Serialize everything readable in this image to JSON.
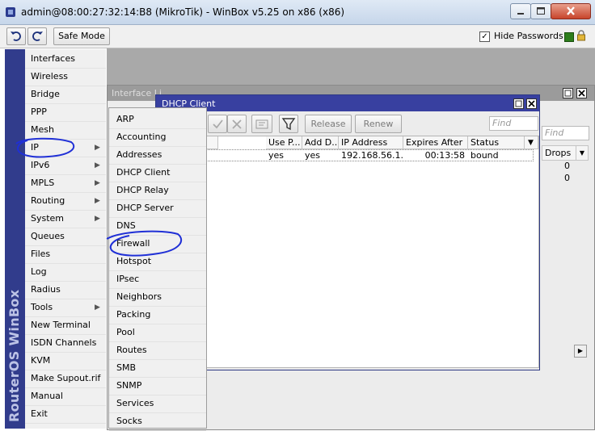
{
  "window": {
    "title": "admin@08:00:27:32:14:B8 (MikroTik) - WinBox v5.25 on x86 (x86)"
  },
  "toolbar": {
    "safe_mode_label": "Safe Mode",
    "hide_passwords_label": "Hide Passwords",
    "hide_passwords_checked": true,
    "hide_passwords_mark": "✓"
  },
  "brand": {
    "text": "RouterOS WinBox",
    "color": "#313c8c"
  },
  "left_menu": {
    "items": [
      {
        "label": "Interfaces",
        "submenu": false
      },
      {
        "label": "Wireless",
        "submenu": false
      },
      {
        "label": "Bridge",
        "submenu": false
      },
      {
        "label": "PPP",
        "submenu": false
      },
      {
        "label": "Mesh",
        "submenu": false
      },
      {
        "label": "IP",
        "submenu": true
      },
      {
        "label": "IPv6",
        "submenu": true
      },
      {
        "label": "MPLS",
        "submenu": true
      },
      {
        "label": "Routing",
        "submenu": true
      },
      {
        "label": "System",
        "submenu": true
      },
      {
        "label": "Queues",
        "submenu": false
      },
      {
        "label": "Files",
        "submenu": false
      },
      {
        "label": "Log",
        "submenu": false
      },
      {
        "label": "Radius",
        "submenu": false
      },
      {
        "label": "Tools",
        "submenu": true
      },
      {
        "label": "New Terminal",
        "submenu": false
      },
      {
        "label": "ISDN Channels",
        "submenu": false
      },
      {
        "label": "KVM",
        "submenu": false
      },
      {
        "label": "Make Supout.rif",
        "submenu": false
      },
      {
        "label": "Manual",
        "submenu": false
      },
      {
        "label": "Exit",
        "submenu": false
      }
    ],
    "submenu_arrow": "▶"
  },
  "ip_submenu": {
    "items": [
      "ARP",
      "Accounting",
      "Addresses",
      "DHCP Client",
      "DHCP Relay",
      "DHCP Server",
      "DNS",
      "Firewall",
      "Hotspot",
      "IPsec",
      "Neighbors",
      "Packing",
      "Pool",
      "Routes",
      "SMB",
      "SNMP",
      "Services",
      "Socks"
    ]
  },
  "interface_window": {
    "title": "Interface List",
    "title_visible": "Interface Li",
    "find_placeholder": "Find",
    "drops_header": "Drops",
    "drops_values": [
      "0",
      "0"
    ]
  },
  "dhcp_window": {
    "title": "DHCP Client",
    "release_label": "Release",
    "renew_label": "Renew",
    "find_placeholder": "Find",
    "columns": [
      "ce",
      "Use P...",
      "Add D...",
      "IP Address",
      "Expires After",
      "Status"
    ],
    "rows": [
      {
        "iface": "",
        "use_peer": "yes",
        "add_default": "yes",
        "ip": "192.168.56.1...",
        "expires": "00:13:58",
        "status": "bound"
      }
    ]
  },
  "annotation_color": "#1f2fd6"
}
